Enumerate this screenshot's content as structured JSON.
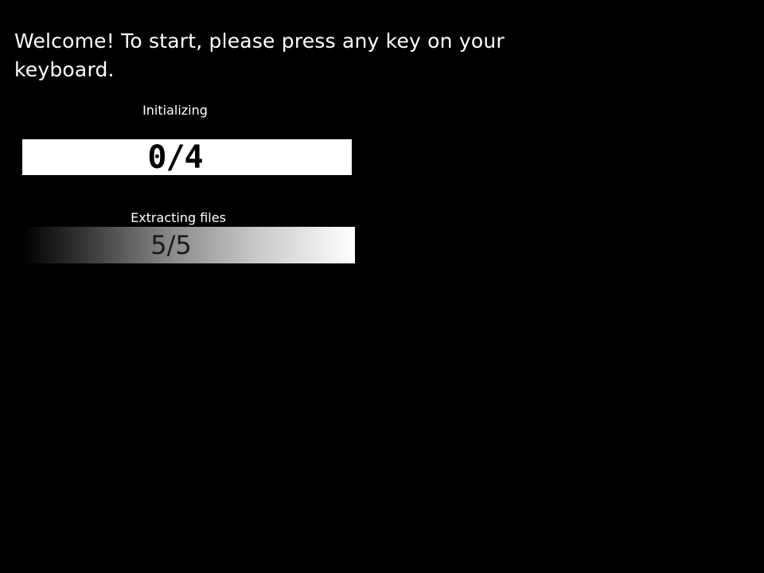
{
  "welcome": {
    "message": "Welcome! To start, please press any key on your keyboard."
  },
  "stages": [
    {
      "label": "Initializing",
      "progress_text": "0/4",
      "completed": 0,
      "total": 4
    },
    {
      "label": "Extracting files",
      "progress_text": "5/5",
      "completed": 5,
      "total": 5
    }
  ],
  "colors": {
    "background": "#000000",
    "text": "#ffffff",
    "bar_background": "#ffffff",
    "bar_text": "#000000"
  }
}
